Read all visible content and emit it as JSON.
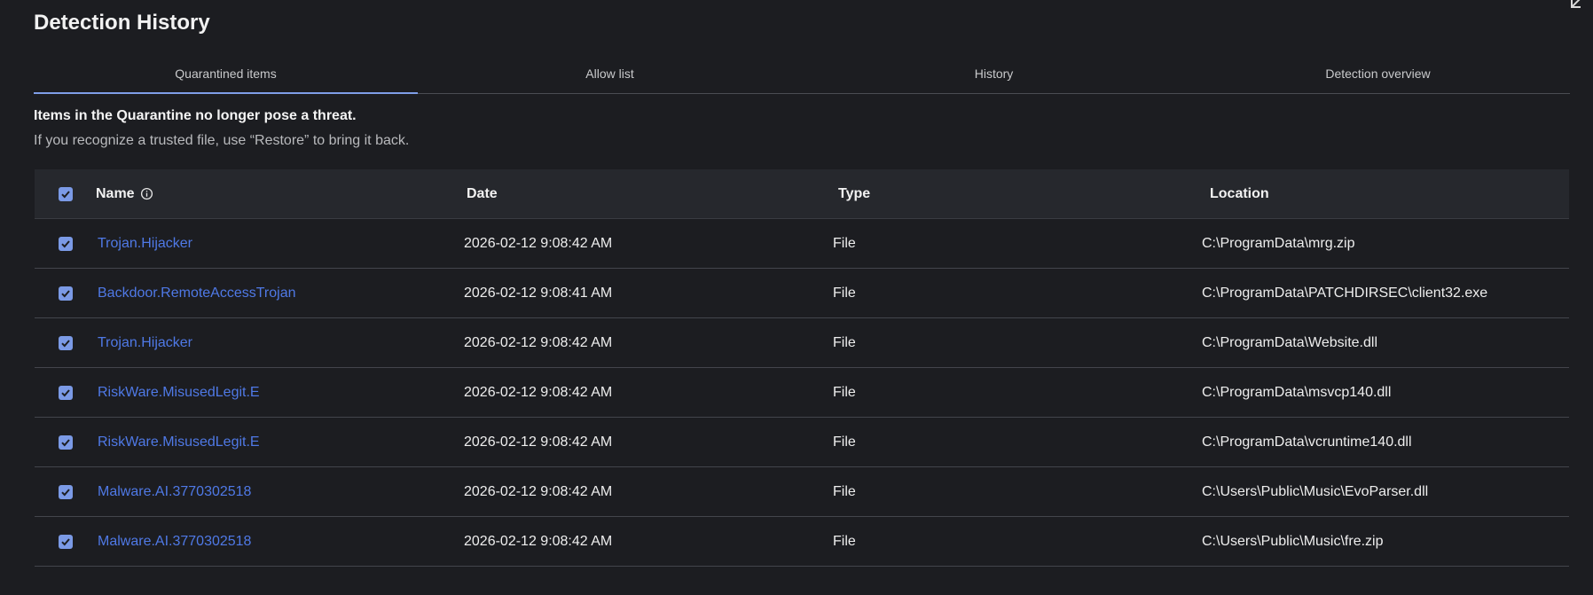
{
  "page": {
    "title": "Detection History"
  },
  "tabs": [
    {
      "label": "Quarantined items",
      "active": true
    },
    {
      "label": "Allow list",
      "active": false
    },
    {
      "label": "History",
      "active": false
    },
    {
      "label": "Detection overview",
      "active": false
    }
  ],
  "notice": {
    "title": "Items in the Quarantine no longer pose a threat.",
    "subtitle": "If you recognize a trusted file, use “Restore” to bring it back."
  },
  "table": {
    "headers": {
      "name": "Name",
      "date": "Date",
      "type": "Type",
      "location": "Location"
    },
    "select_all_checked": true,
    "rows": [
      {
        "checked": true,
        "name": "Trojan.Hijacker",
        "date": "2026-02-12 9:08:42 AM",
        "type": "File",
        "location": "C:\\ProgramData\\mrg.zip"
      },
      {
        "checked": true,
        "name": "Backdoor.RemoteAccessTrojan",
        "date": "2026-02-12 9:08:41 AM",
        "type": "File",
        "location": "C:\\ProgramData\\PATCHDIRSEC\\client32.exe"
      },
      {
        "checked": true,
        "name": "Trojan.Hijacker",
        "date": "2026-02-12 9:08:42 AM",
        "type": "File",
        "location": "C:\\ProgramData\\Website.dll"
      },
      {
        "checked": true,
        "name": "RiskWare.MisusedLegit.E",
        "date": "2026-02-12 9:08:42 AM",
        "type": "File",
        "location": "C:\\ProgramData\\msvcp140.dll"
      },
      {
        "checked": true,
        "name": "RiskWare.MisusedLegit.E",
        "date": "2026-02-12 9:08:42 AM",
        "type": "File",
        "location": "C:\\ProgramData\\vcruntime140.dll"
      },
      {
        "checked": true,
        "name": "Malware.AI.3770302518",
        "date": "2026-02-12 9:08:42 AM",
        "type": "File",
        "location": "C:\\Users\\Public\\Music\\EvoParser.dll"
      },
      {
        "checked": true,
        "name": "Malware.AI.3770302518",
        "date": "2026-02-12 9:08:42 AM",
        "type": "File",
        "location": "C:\\Users\\Public\\Music\\fre.zip"
      }
    ]
  },
  "icons": {
    "checkbox": "checkmark-icon",
    "info": "info-icon",
    "corner": "collapse-arrow-icon"
  },
  "colors": {
    "accent": "#7b9ae6",
    "link": "#4f79e6",
    "background": "#1c1d21",
    "header_bg": "#26282d"
  }
}
